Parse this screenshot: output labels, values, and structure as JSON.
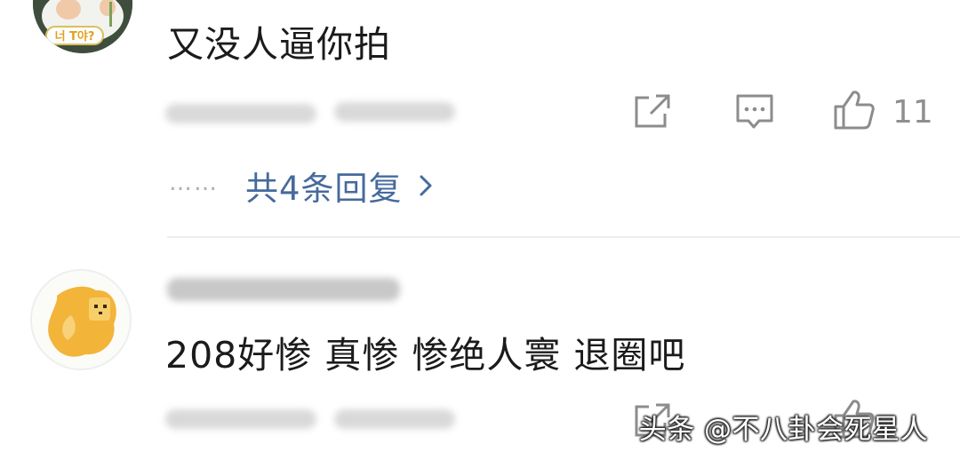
{
  "comments": [
    {
      "text": "又没人逼你拍",
      "likes": "11",
      "avatar_badge": "너 T야?",
      "replies_label": "共4条回复",
      "replies_dots": "……",
      "actions": [
        "share-icon",
        "comment-icon",
        "like-icon"
      ]
    },
    {
      "text": "208好惨 真惨 惨绝人寰 退圈吧",
      "actions": [
        "share-icon",
        "like-icon"
      ]
    }
  ],
  "watermark": "头条 @不八卦会死星人",
  "colors": {
    "reply_link": "#466a9c",
    "icon_gray": "#8c8c8c",
    "divider": "#ececec"
  }
}
